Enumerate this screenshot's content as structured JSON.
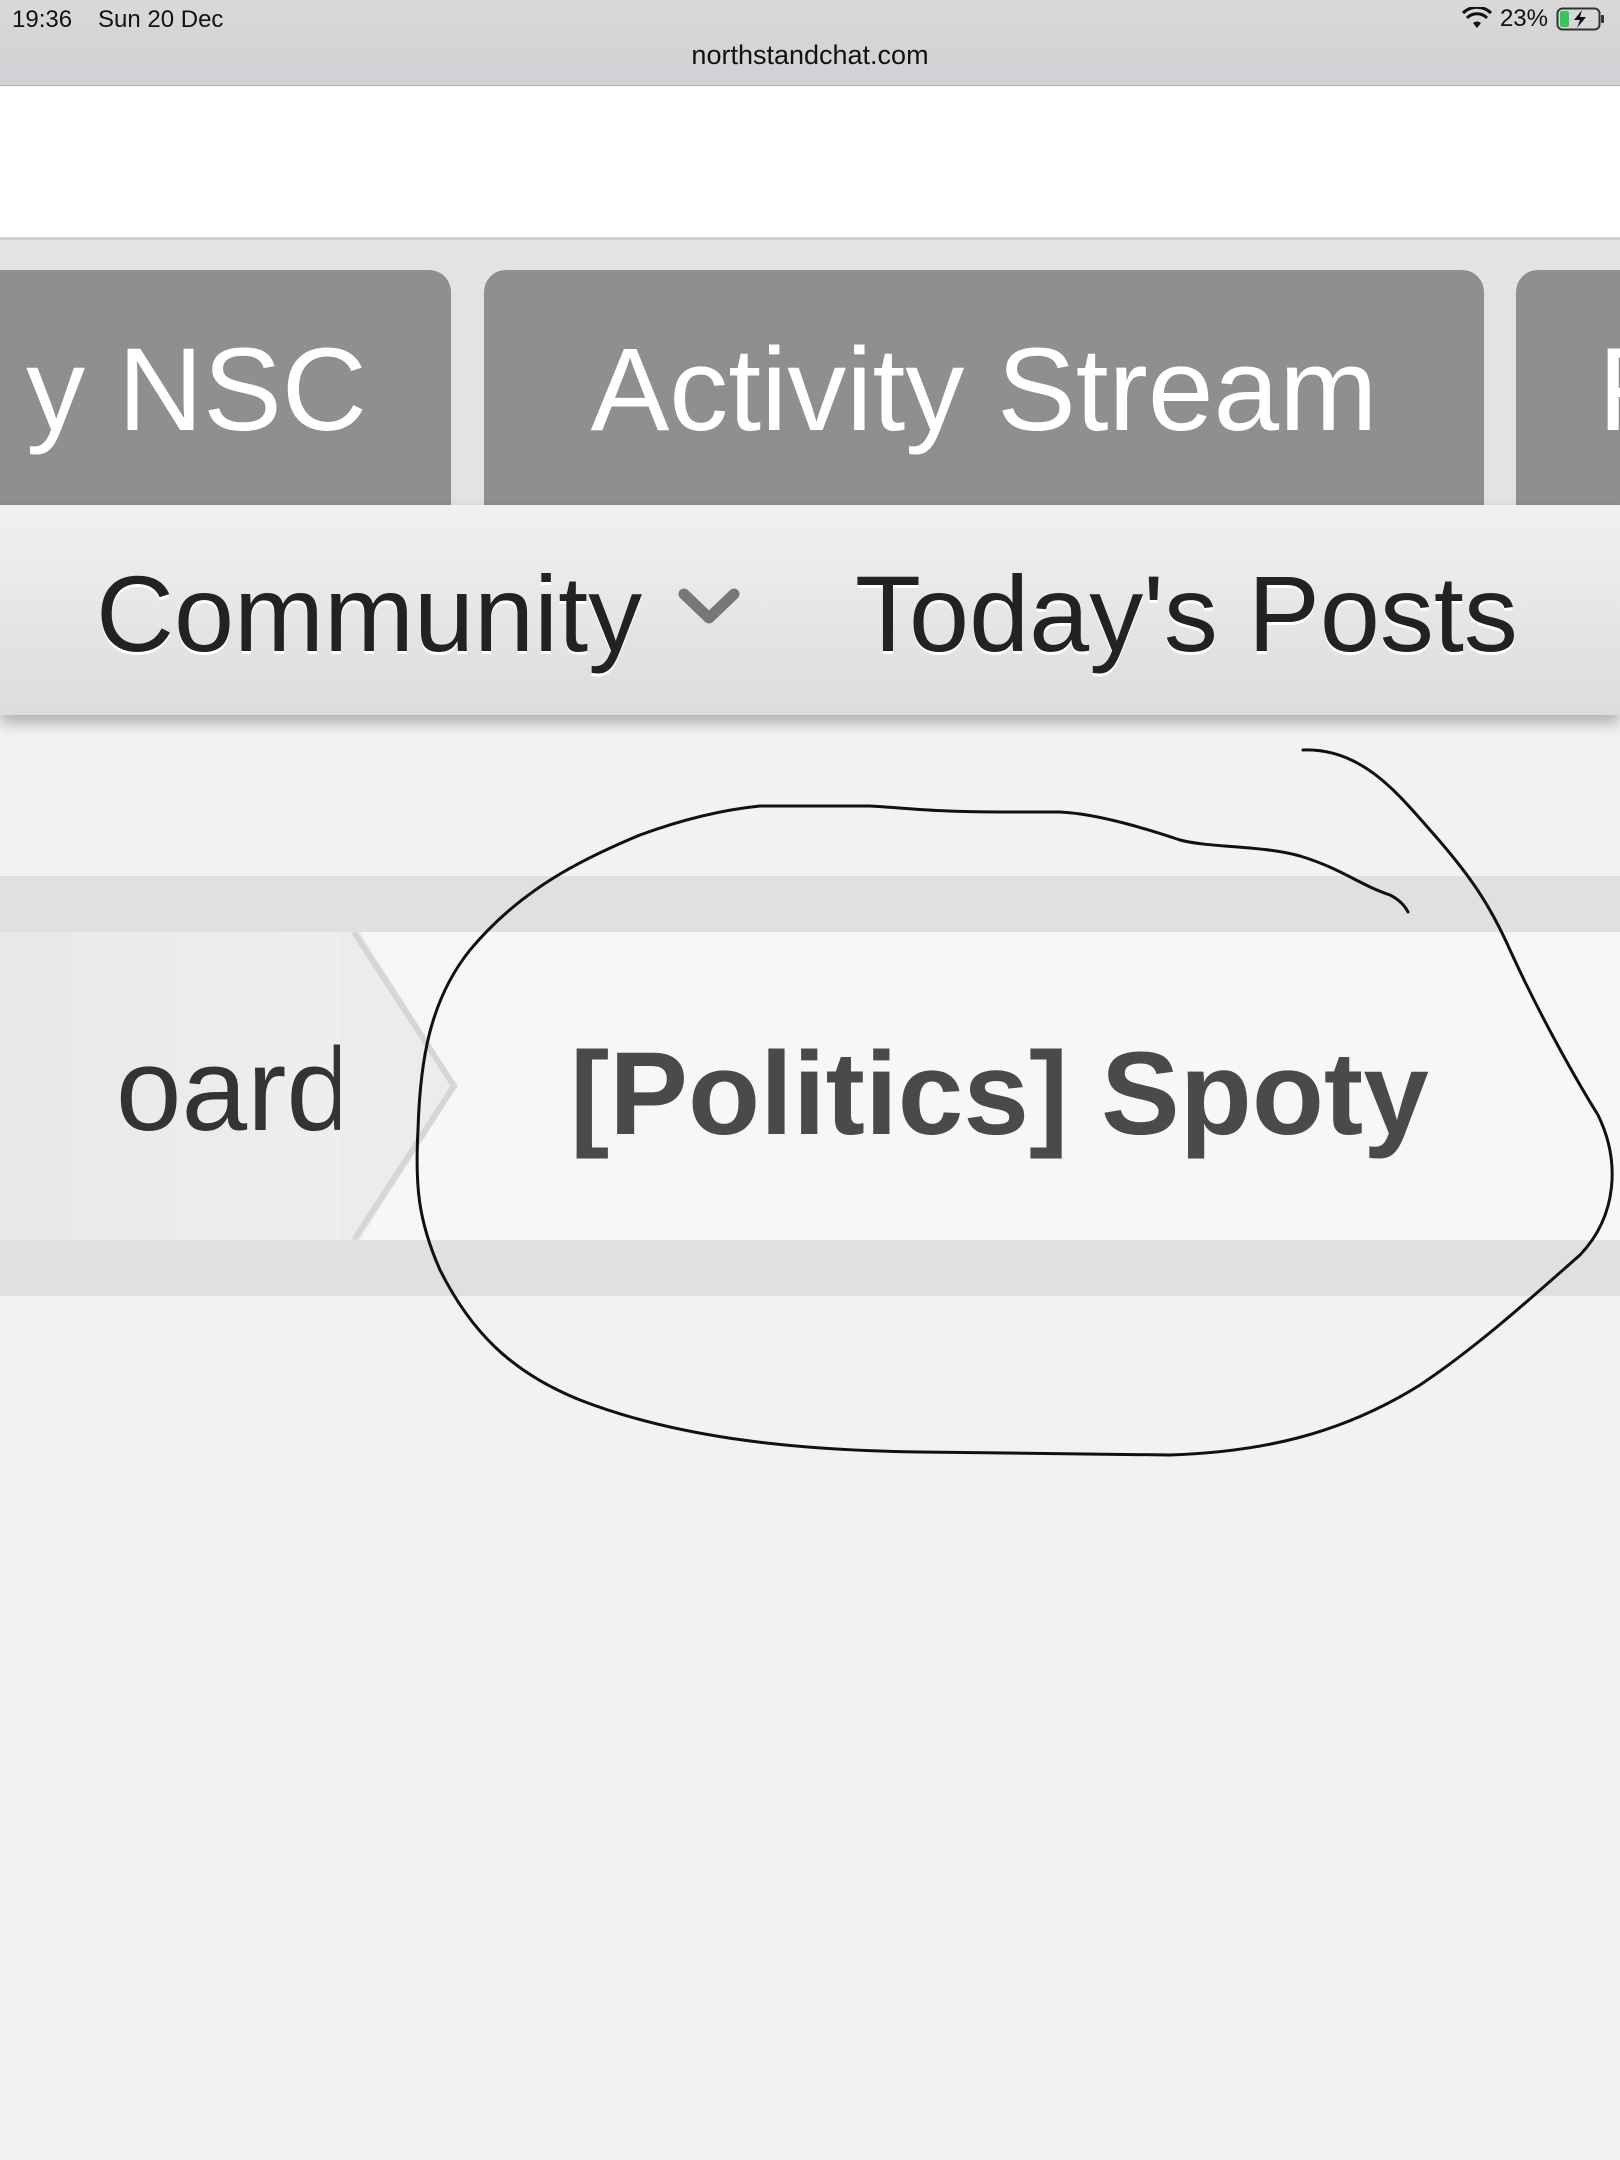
{
  "status_bar": {
    "time": "19:36",
    "date": "Sun 20 Dec",
    "battery_percent": "23%",
    "url": "northstandchat.com"
  },
  "tabs": [
    {
      "label": "y NSC"
    },
    {
      "label": "Activity Stream"
    },
    {
      "label": "F"
    }
  ],
  "subnav": {
    "community_label": "Community",
    "todays_posts_label": "Today's Posts"
  },
  "breadcrumb": {
    "previous_label": "oard",
    "current_label": "[Politics] Spoty"
  },
  "colors": {
    "tab_bg": "#8f8f8f",
    "page_bg": "#f2f2f2",
    "breadcrumb_current": "#4a4a4a",
    "annotation_stroke": "#111111"
  }
}
